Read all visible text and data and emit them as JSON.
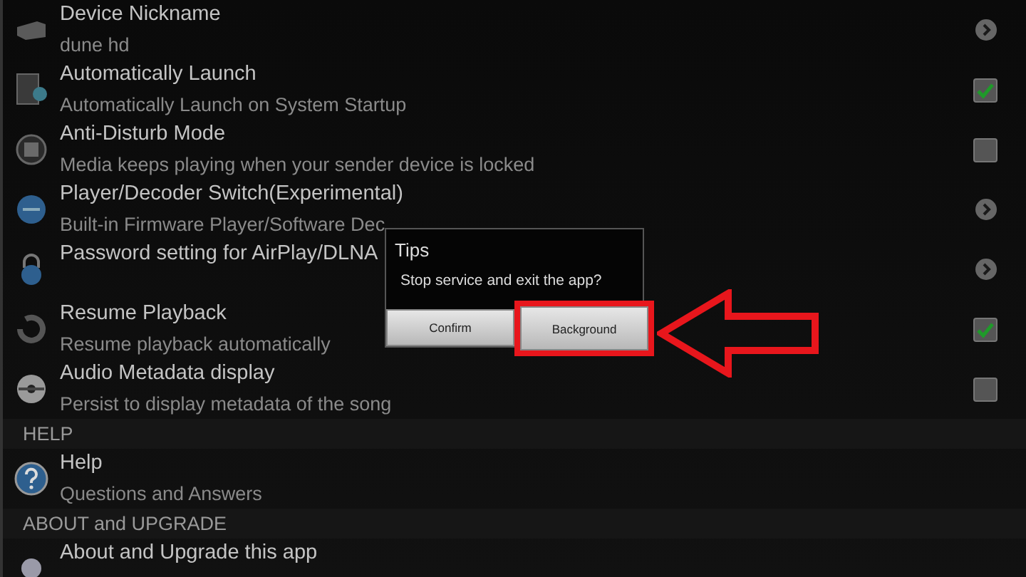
{
  "settings": [
    {
      "kind": "chevron",
      "title": "Device Nickname",
      "subtitle": "dune hd"
    },
    {
      "kind": "checkbox",
      "title": "Automatically Launch",
      "subtitle": "Automatically Launch on System Startup",
      "checked": true
    },
    {
      "kind": "checkbox",
      "title": "Anti-Disturb Mode",
      "subtitle": "Media keeps playing when your sender device is locked",
      "checked": false
    },
    {
      "kind": "chevron",
      "title": "Player/Decoder Switch(Experimental)",
      "subtitle": "Built-in Firmware Player/Software Dec"
    },
    {
      "kind": "chevron",
      "title": "Password setting for AirPlay/DLNA"
    },
    {
      "kind": "checkbox",
      "title": "Resume Playback",
      "subtitle": "Resume playback automatically",
      "checked": true
    },
    {
      "kind": "checkbox",
      "title": "Audio Metadata display",
      "subtitle": "Persist to display metadata of the song",
      "checked": false
    },
    {
      "kind": "header",
      "title": "HELP"
    },
    {
      "kind": "plain",
      "title": "Help",
      "subtitle": "Questions and Answers"
    },
    {
      "kind": "header",
      "title": "ABOUT and UPGRADE"
    },
    {
      "kind": "plain",
      "title": "About and Upgrade this app"
    }
  ],
  "dialog": {
    "title": "Tips",
    "message": "Stop service and exit the app?",
    "buttons": [
      {
        "label": "Confirm",
        "highlighted": false
      },
      {
        "label": "Background",
        "highlighted": true
      }
    ]
  }
}
